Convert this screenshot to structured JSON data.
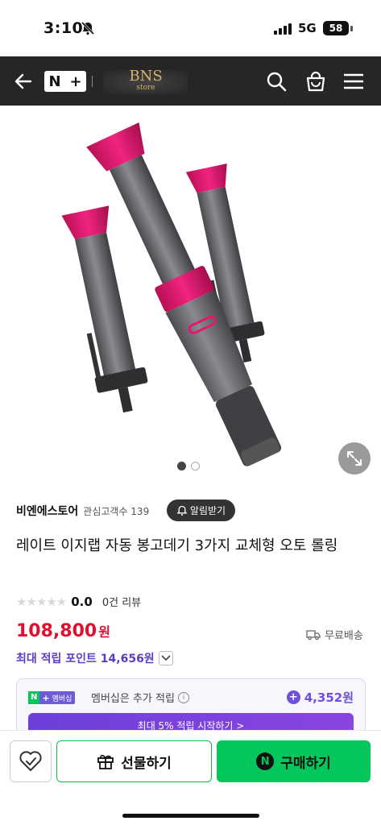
{
  "status_bar": {
    "time": "3:10",
    "network": "5G",
    "battery": "58"
  },
  "nav": {
    "brand_main": "BNS",
    "brand_sub": "store",
    "nplus_n": "N",
    "nplus_plus": "+"
  },
  "gallery": {
    "current_slide": 1,
    "total_slides": 2
  },
  "store": {
    "name": "비엔에스토어",
    "followers_label": "관심고객수 139",
    "alarm_button": "알림받기"
  },
  "product": {
    "title": "레이트 이지랩 자동 봉고데기 3가지 교체형 오토 롤링",
    "rating_stars": "★★★★★",
    "rating_score": "0.0",
    "review_count": "0건 리뷰",
    "price": "108,800",
    "currency": "원",
    "shipping": "무료배송",
    "max_points": "최대 적립 포인트 14,656원"
  },
  "membership": {
    "tag": "멤버십",
    "text": "멤버십은 추가 적립",
    "points": "4,352원",
    "cta": "최대 5% 적립 시작하기 >"
  },
  "actions": {
    "gift": "선물하기",
    "buy": "구매하기",
    "buy_logo": "N"
  },
  "colors": {
    "price": "#e0102f",
    "points": "#5b3cc4",
    "buy": "#03c75a",
    "nav_bg": "#262626",
    "product_accent": "#e5186e"
  }
}
